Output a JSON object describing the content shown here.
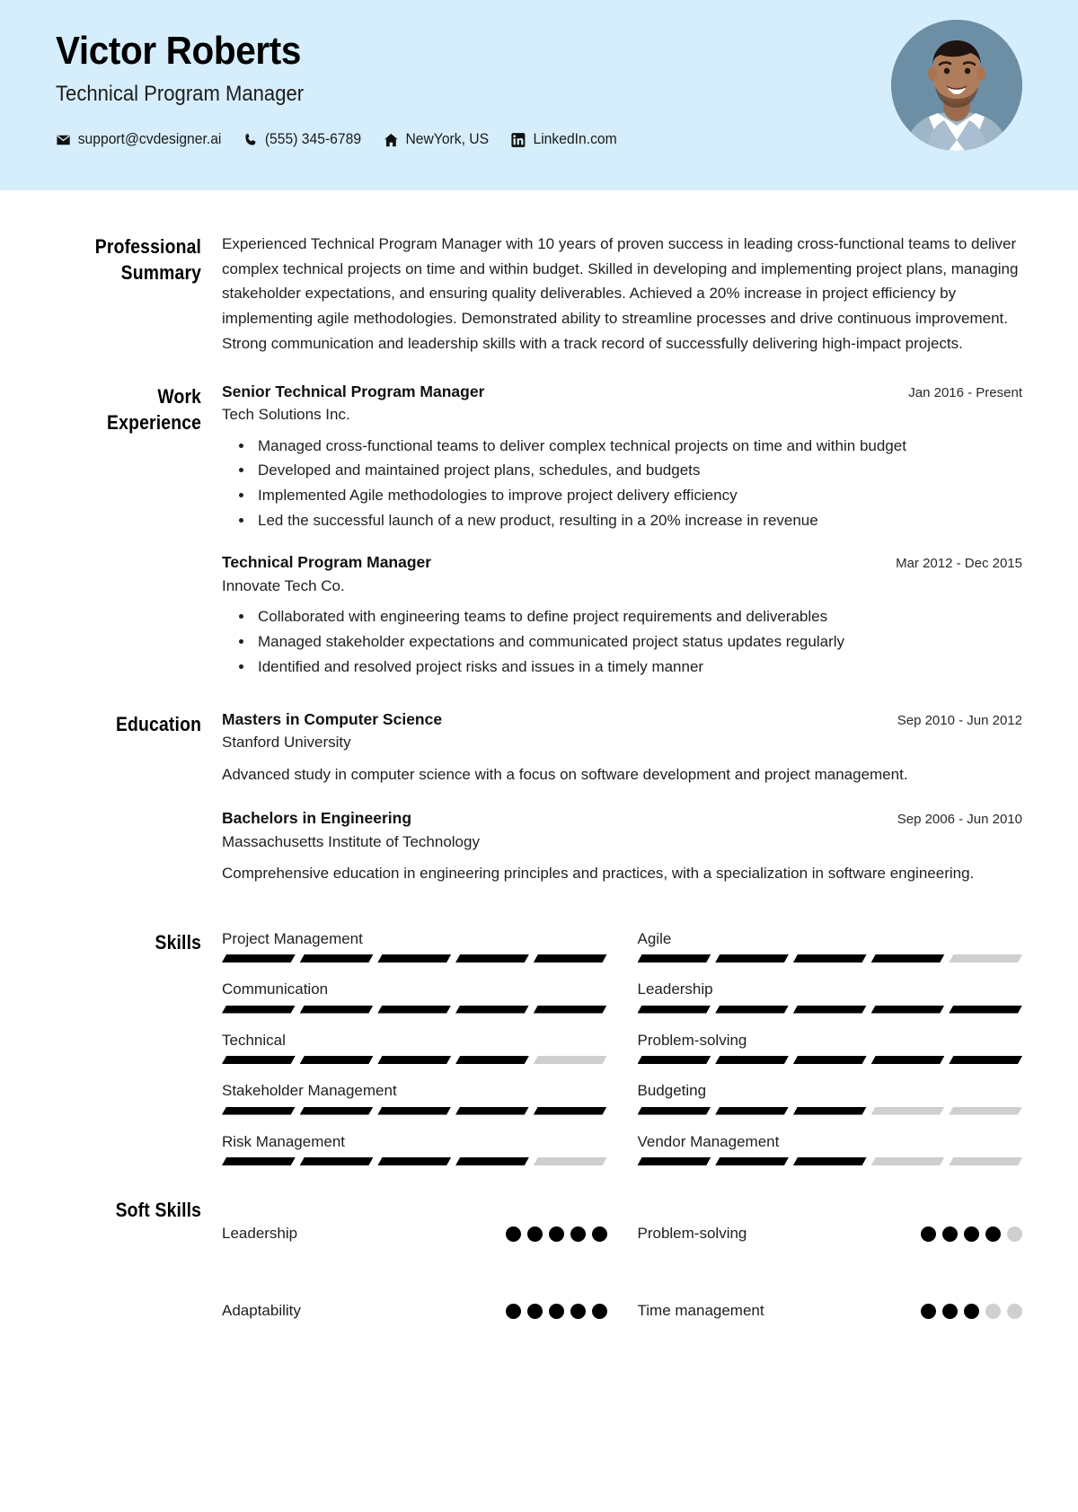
{
  "header": {
    "name": "Victor Roberts",
    "job_title": "Technical Program Manager",
    "background_color": "#d6eefc",
    "contacts": [
      {
        "icon": "envelope-icon",
        "label": "support@cvdesigner.ai"
      },
      {
        "icon": "phone-icon",
        "label": "(555) 345-6789"
      },
      {
        "icon": "home-icon",
        "label": "NewYork, US"
      },
      {
        "icon": "linkedin-icon",
        "label": "LinkedIn.com"
      }
    ],
    "avatar_alt": "Portrait photo of Victor Roberts"
  },
  "sections": {
    "summary": {
      "label": "Professional Summary",
      "text": "Experienced Technical Program Manager with 10 years of proven success in leading cross-functional teams to deliver complex technical projects on time and within budget. Skilled in developing and implementing project plans, managing stakeholder expectations, and ensuring quality deliverables. Achieved a 20% increase in project efficiency by implementing agile methodologies. Demonstrated ability to streamline processes and drive continuous improvement. Strong communication and leadership skills with a track record of successfully delivering high-impact projects."
    },
    "experience": {
      "label": "Work Experience",
      "entries": [
        {
          "title": "Senior Technical Program Manager",
          "organization": "Tech Solutions Inc.",
          "date": "Jan 2016 - Present",
          "bullets": [
            "Managed cross-functional teams to deliver complex technical projects on time and within budget",
            "Developed and maintained project plans, schedules, and budgets",
            "Implemented Agile methodologies to improve project delivery efficiency",
            "Led the successful launch of a new product, resulting in a 20% increase in revenue"
          ]
        },
        {
          "title": "Technical Program Manager",
          "organization": "Innovate Tech Co.",
          "date": "Mar 2012 - Dec 2015",
          "bullets": [
            "Collaborated with engineering teams to define project requirements and deliverables",
            "Managed stakeholder expectations and communicated project status updates regularly",
            "Identified and resolved project risks and issues in a timely manner"
          ]
        }
      ]
    },
    "education": {
      "label": "Education",
      "entries": [
        {
          "title": "Masters in Computer Science",
          "organization": "Stanford University",
          "date": "Sep 2010 - Jun 2012",
          "description": "Advanced study in computer science with a focus on software development and project management."
        },
        {
          "title": "Bachelors in Engineering",
          "organization": "Massachusetts Institute of Technology",
          "date": "Sep 2006 - Jun 2010",
          "description": "Comprehensive education in engineering principles and practices, with a specialization in software engineering."
        }
      ]
    },
    "skills": {
      "label": "Skills",
      "max_level": 5,
      "filled_color": "#000000",
      "empty_color": "#cfcfcf",
      "items": [
        {
          "name": "Project Management",
          "level": 5
        },
        {
          "name": "Agile",
          "level": 4
        },
        {
          "name": "Communication",
          "level": 5
        },
        {
          "name": "Leadership",
          "level": 5
        },
        {
          "name": "Technical",
          "level": 4
        },
        {
          "name": "Problem-solving",
          "level": 5
        },
        {
          "name": "Stakeholder Management",
          "level": 5
        },
        {
          "name": "Budgeting",
          "level": 3
        },
        {
          "name": "Risk Management",
          "level": 4
        },
        {
          "name": "Vendor Management",
          "level": 3
        }
      ]
    },
    "soft_skills": {
      "label": "Soft Skills",
      "max_level": 5,
      "filled_color": "#000000",
      "empty_color": "#cfcfcf",
      "items": [
        {
          "name": "Leadership",
          "level": 5
        },
        {
          "name": "Problem-solving",
          "level": 4
        },
        {
          "name": "Adaptability",
          "level": 5
        },
        {
          "name": "Time management",
          "level": 3
        }
      ]
    }
  }
}
